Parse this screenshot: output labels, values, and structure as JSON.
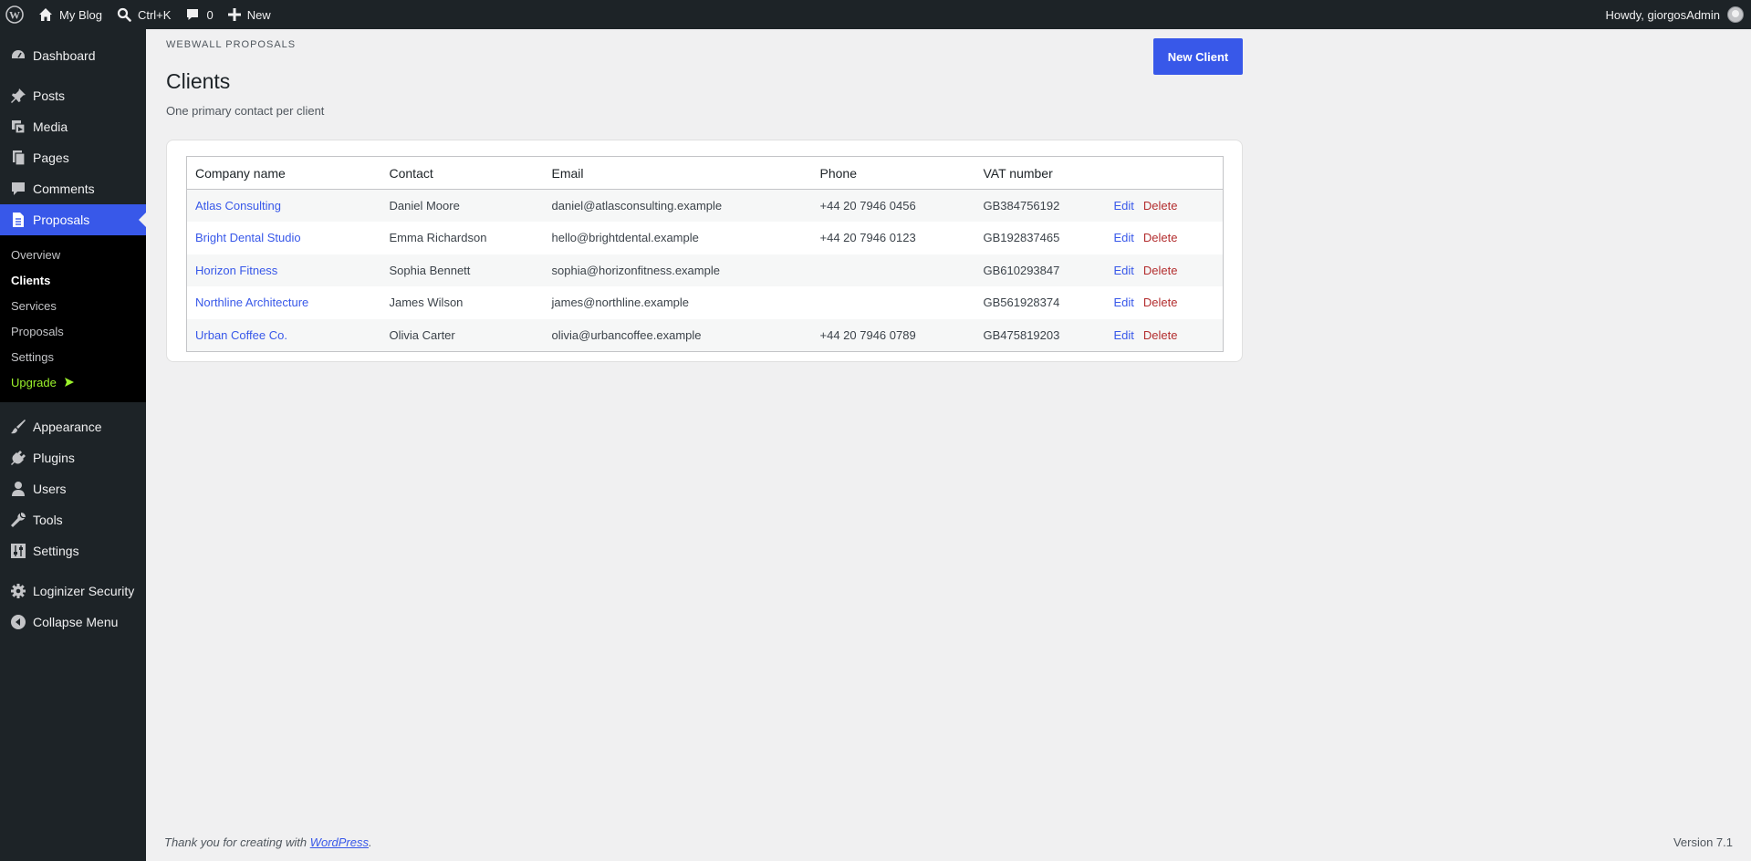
{
  "adminbar": {
    "site_name": "My Blog",
    "search_shortcut": "Ctrl+K",
    "comments_count": "0",
    "new_label": "New",
    "howdy": "Howdy, giorgosAdmin"
  },
  "sidebar": {
    "dashboard": "Dashboard",
    "posts": "Posts",
    "media": "Media",
    "pages": "Pages",
    "comments": "Comments",
    "proposals": "Proposals",
    "submenu": {
      "overview": "Overview",
      "clients": "Clients",
      "services": "Services",
      "proposals": "Proposals",
      "settings": "Settings",
      "upgrade": "Upgrade"
    },
    "appearance": "Appearance",
    "plugins": "Plugins",
    "users": "Users",
    "tools": "Tools",
    "settings": "Settings",
    "loginizer": "Loginizer Security",
    "collapse": "Collapse Menu"
  },
  "header": {
    "eyebrow": "WEBWALL PROPOSALS",
    "title": "Clients",
    "subtitle": "One primary contact per client",
    "new_button": "New Client"
  },
  "table": {
    "columns": [
      "Company name",
      "Contact",
      "Email",
      "Phone",
      "VAT number"
    ],
    "rows": [
      {
        "company": "Atlas Consulting",
        "contact": "Daniel Moore",
        "email": "daniel@atlasconsulting.example",
        "phone": "+44 20 7946 0456",
        "vat": "GB384756192"
      },
      {
        "company": "Bright Dental Studio",
        "contact": "Emma Richardson",
        "email": "hello@brightdental.example",
        "phone": "+44 20 7946 0123",
        "vat": "GB192837465"
      },
      {
        "company": "Horizon Fitness",
        "contact": "Sophia Bennett",
        "email": "sophia@horizonfitness.example",
        "phone": "",
        "vat": "GB610293847"
      },
      {
        "company": "Northline Architecture",
        "contact": "James Wilson",
        "email": "james@northline.example",
        "phone": "",
        "vat": "GB561928374"
      },
      {
        "company": "Urban Coffee Co.",
        "contact": "Olivia Carter",
        "email": "olivia@urbancoffee.example",
        "phone": "+44 20 7946 0789",
        "vat": "GB475819203"
      }
    ],
    "edit_label": "Edit",
    "delete_label": "Delete"
  },
  "footer": {
    "thanks_prefix": "Thank you for creating with ",
    "wp_link": "WordPress",
    "thanks_suffix": ".",
    "version": "Version 7.1"
  },
  "colors": {
    "accent": "#3858e9",
    "admin_dark": "#1d2327",
    "delete": "#b32d2e",
    "upgrade": "#9bf22b"
  }
}
